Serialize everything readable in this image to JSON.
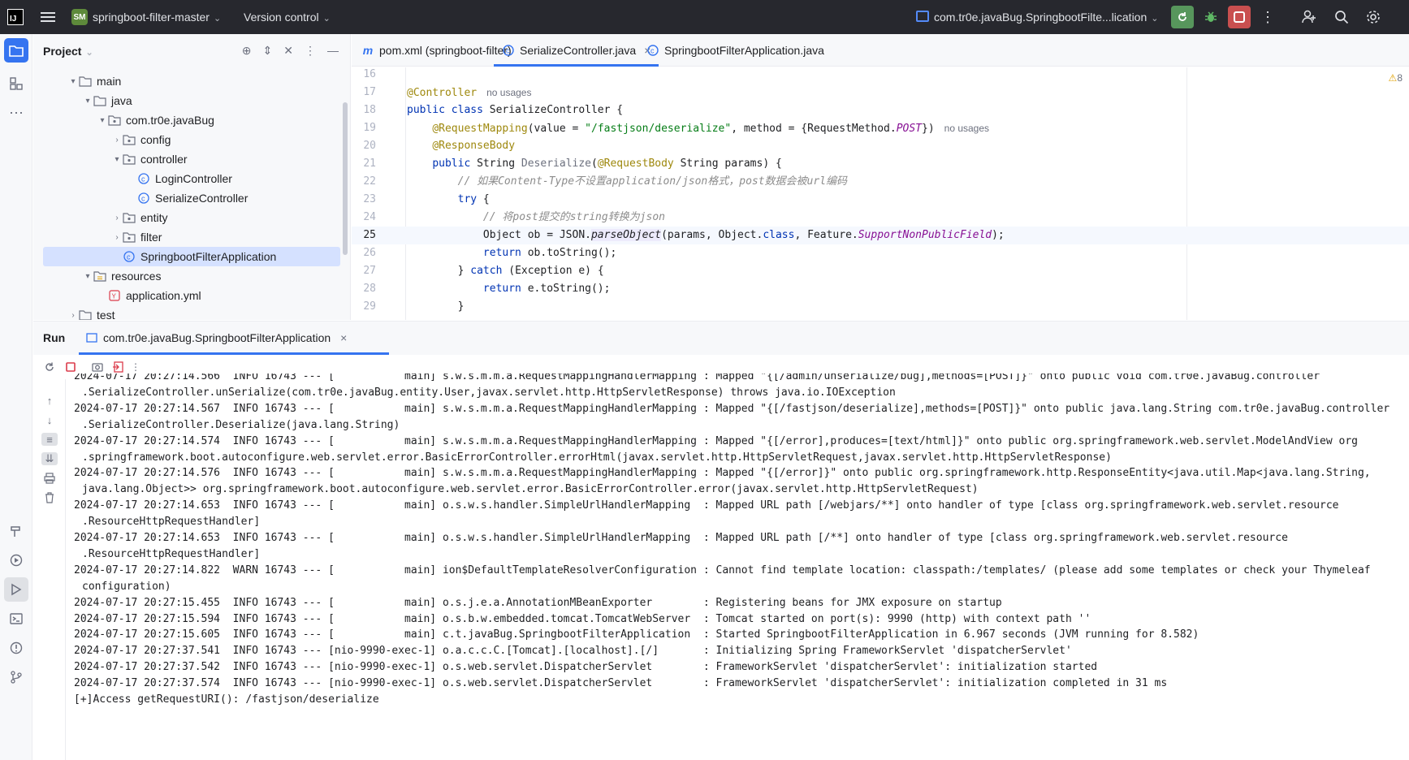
{
  "titlebar": {
    "logo": "IJ",
    "project_badge": "SM",
    "project_name": "springboot-filter-master",
    "version_control": "Version control",
    "run_config": "com.tr0e.javaBug.SpringbootFilte...lication"
  },
  "project_panel": {
    "title": "Project",
    "tree": [
      {
        "label": "main",
        "indent": 2,
        "arrow": "▾",
        "icon": "folder-icon"
      },
      {
        "label": "java",
        "indent": 3,
        "arrow": "▾",
        "icon": "folder-icon"
      },
      {
        "label": "com.tr0e.javaBug",
        "indent": 4,
        "arrow": "▾",
        "icon": "package-icon"
      },
      {
        "label": "config",
        "indent": 5,
        "arrow": "›",
        "icon": "package-icon"
      },
      {
        "label": "controller",
        "indent": 5,
        "arrow": "▾",
        "icon": "package-icon"
      },
      {
        "label": "LoginController",
        "indent": 6,
        "arrow": "",
        "icon": "class-icon"
      },
      {
        "label": "SerializeController",
        "indent": 6,
        "arrow": "",
        "icon": "class-icon"
      },
      {
        "label": "entity",
        "indent": 5,
        "arrow": "›",
        "icon": "package-icon"
      },
      {
        "label": "filter",
        "indent": 5,
        "arrow": "›",
        "icon": "package-icon"
      },
      {
        "label": "SpringbootFilterApplication",
        "indent": 5,
        "arrow": "",
        "icon": "springboot-class-icon",
        "selected": true
      },
      {
        "label": "resources",
        "indent": 3,
        "arrow": "▾",
        "icon": "resources-folder-icon"
      },
      {
        "label": "application.yml",
        "indent": 4,
        "arrow": "",
        "icon": "yaml-icon"
      },
      {
        "label": "test",
        "indent": 2,
        "arrow": "›",
        "icon": "folder-icon"
      }
    ]
  },
  "editor": {
    "tabs": [
      {
        "label": "pom.xml (springboot-filter)",
        "icon": "maven-icon"
      },
      {
        "label": "SerializeController.java",
        "icon": "class-icon",
        "active": true,
        "close": "×"
      },
      {
        "label": "SpringbootFilterApplication.java",
        "icon": "springboot-class-icon"
      }
    ],
    "warning_count": "8",
    "line_numbers": [
      "16",
      "17",
      "18",
      "19",
      "20",
      "21",
      "22",
      "23",
      "24",
      "25",
      "26",
      "27",
      "28",
      "29"
    ],
    "current_line": "25",
    "hints": {
      "no_usages": "no usages"
    },
    "code": {
      "l17": "@Controller",
      "l18_kw": "public class ",
      "l18_rest": "SerializeController {",
      "l19_an": "@RequestMapping",
      "l19_a": "(value = ",
      "l19_str": "\"/fastjson/deserialize\"",
      "l19_b": ", method = {RequestMethod.",
      "l19_post": "POST",
      "l19_c": "})",
      "l20": "@ResponseBody",
      "l21_kw": "public ",
      "l21_a": "String ",
      "l21_fn": "Deserialize",
      "l21_b": "(",
      "l21_an": "@RequestBody",
      "l21_c": " String params) {",
      "l22": "// 如果Content-Type不设置application/json格式，post数据会被url编码",
      "l23_kw": "try",
      "l23_rest": " {",
      "l24": "// 将post提交的string转换为json",
      "l25_a": "Object ob = JSON.",
      "l25_fn": "parseObject",
      "l25_b": "(params, Object.",
      "l25_cls": "class",
      "l25_c": ", Feature.",
      "l25_feat": "SupportNonPublicField",
      "l25_d": ");",
      "l26_kw": "return",
      "l26_rest": " ob.toString();",
      "l27_a": "} ",
      "l27_kw": "catch",
      "l27_rest": " (Exception e) {",
      "l28_kw": "return",
      "l28_rest": " e.toString();",
      "l29": "}"
    }
  },
  "run_panel": {
    "title": "Run",
    "tab_label": "com.tr0e.javaBug.SpringbootFilterApplication",
    "tab_close": "×",
    "console_lines": [
      {
        "text": "2024-07-17 20:27:14.566  INFO 16743 --- [           main] s.w.s.m.m.a.RequestMappingHandlerMapping : Mapped \"{[/admin/unserialize/bug],methods=[POST]}\" onto public void com.tr0e.javaBug.controller"
      },
      {
        "text": ".SerializeController.unSerialize(com.tr0e.javaBug.entity.User,javax.servlet.http.HttpServletResponse) throws java.io.IOException",
        "cont": true
      },
      {
        "text": "2024-07-17 20:27:14.567  INFO 16743 --- [           main] s.w.s.m.m.a.RequestMappingHandlerMapping : Mapped \"{[/fastjson/deserialize],methods=[POST]}\" onto public java.lang.String com.tr0e.javaBug.controller"
      },
      {
        "text": ".SerializeController.Deserialize(java.lang.String)",
        "cont": true
      },
      {
        "text": "2024-07-17 20:27:14.574  INFO 16743 --- [           main] s.w.s.m.m.a.RequestMappingHandlerMapping : Mapped \"{[/error],produces=[text/html]}\" onto public org.springframework.web.servlet.ModelAndView org"
      },
      {
        "text": ".springframework.boot.autoconfigure.web.servlet.error.BasicErrorController.errorHtml(javax.servlet.http.HttpServletRequest,javax.servlet.http.HttpServletResponse)",
        "cont": true
      },
      {
        "text": "2024-07-17 20:27:14.576  INFO 16743 --- [           main] s.w.s.m.m.a.RequestMappingHandlerMapping : Mapped \"{[/error]}\" onto public org.springframework.http.ResponseEntity<java.util.Map<java.lang.String,"
      },
      {
        "text": "java.lang.Object>> org.springframework.boot.autoconfigure.web.servlet.error.BasicErrorController.error(javax.servlet.http.HttpServletRequest)",
        "cont": true
      },
      {
        "text": "2024-07-17 20:27:14.653  INFO 16743 --- [           main] o.s.w.s.handler.SimpleUrlHandlerMapping  : Mapped URL path [/webjars/**] onto handler of type [class org.springframework.web.servlet.resource"
      },
      {
        "text": ".ResourceHttpRequestHandler]",
        "cont": true
      },
      {
        "text": "2024-07-17 20:27:14.653  INFO 16743 --- [           main] o.s.w.s.handler.SimpleUrlHandlerMapping  : Mapped URL path [/**] onto handler of type [class org.springframework.web.servlet.resource"
      },
      {
        "text": ".ResourceHttpRequestHandler]",
        "cont": true
      },
      {
        "text": "2024-07-17 20:27:14.822  WARN 16743 --- [           main] ion$DefaultTemplateResolverConfiguration : Cannot find template location: classpath:/templates/ (please add some templates or check your Thymeleaf"
      },
      {
        "text": "configuration)",
        "cont": true
      },
      {
        "text": "2024-07-17 20:27:15.455  INFO 16743 --- [           main] o.s.j.e.a.AnnotationMBeanExporter        : Registering beans for JMX exposure on startup"
      },
      {
        "text": "2024-07-17 20:27:15.594  INFO 16743 --- [           main] o.s.b.w.embedded.tomcat.TomcatWebServer  : Tomcat started on port(s): 9990 (http) with context path ''"
      },
      {
        "text": "2024-07-17 20:27:15.605  INFO 16743 --- [           main] c.t.javaBug.SpringbootFilterApplication  : Started SpringbootFilterApplication in 6.967 seconds (JVM running for 8.582)"
      },
      {
        "text": "2024-07-17 20:27:37.541  INFO 16743 --- [nio-9990-exec-1] o.a.c.c.C.[Tomcat].[localhost].[/]       : Initializing Spring FrameworkServlet 'dispatcherServlet'"
      },
      {
        "text": "2024-07-17 20:27:37.542  INFO 16743 --- [nio-9990-exec-1] o.s.web.servlet.DispatcherServlet        : FrameworkServlet 'dispatcherServlet': initialization started"
      },
      {
        "text": "2024-07-17 20:27:37.574  INFO 16743 --- [nio-9990-exec-1] o.s.web.servlet.DispatcherServlet        : FrameworkServlet 'dispatcherServlet': initialization completed in 31 ms"
      },
      {
        "text": "[+]Access getRequestURI(): /fastjson/deserialize"
      }
    ]
  },
  "colors": {
    "titlebar_bg": "#27282e",
    "accent": "#3574f0",
    "run_green": "#57965c",
    "stop_red": "#c94f4f",
    "selection": "#d5e1ff"
  }
}
